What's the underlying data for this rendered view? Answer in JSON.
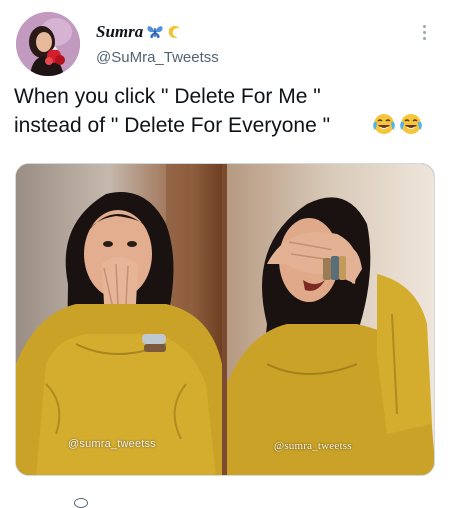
{
  "author": {
    "display_name": "Sumra",
    "handle": "@SuMra_Tweetss"
  },
  "tweet": {
    "text": "When you click \" Delete For Me \"\ninstead of \" Delete For Everyone \"",
    "emojis": [
      "face-with-tears-of-joy",
      "face-with-tears-of-joy"
    ]
  },
  "media": {
    "watermark_left": "@sumra_tweetss",
    "watermark_right": "@sumra_tweetss"
  },
  "colors": {
    "text_primary": "#0f1419",
    "text_secondary": "#536471",
    "shirt_mustard": "#c9a227",
    "background": "#ffffff"
  },
  "icons": {
    "badge_1": "butterfly-icon",
    "badge_2": "crescent-star-icon",
    "menu": "more-options-icon"
  }
}
